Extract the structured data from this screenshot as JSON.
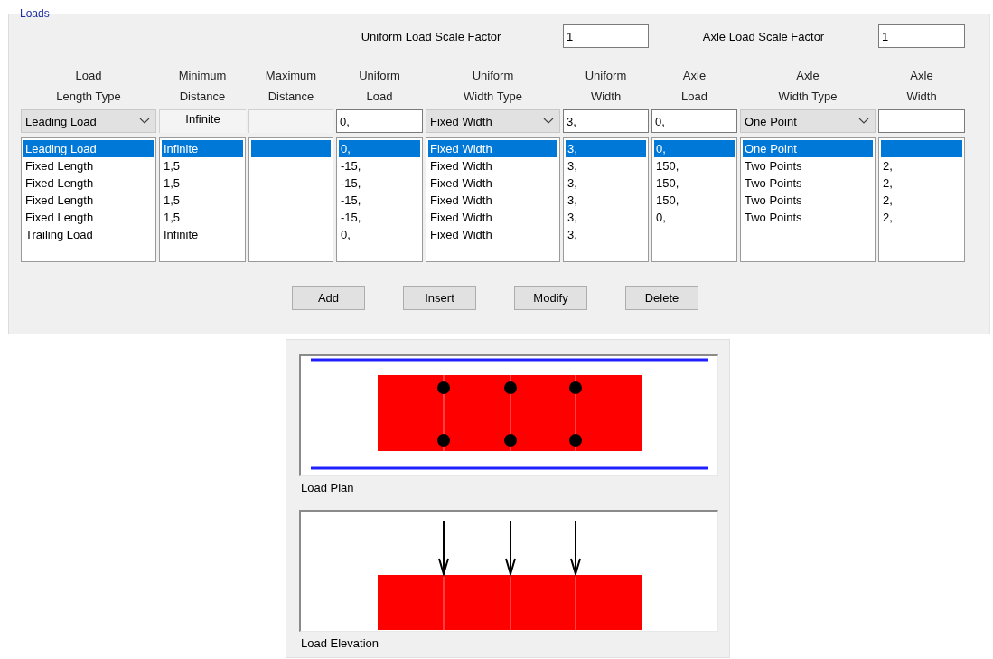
{
  "group": {
    "title": "Loads"
  },
  "scale_factors": [
    {
      "label": "Uniform Load Scale Factor",
      "value": "1"
    },
    {
      "label": "Axle Load Scale Factor",
      "value": "1"
    }
  ],
  "columns": [
    {
      "header": [
        "Load",
        "Length Type"
      ],
      "editor": {
        "kind": "combo",
        "value": "Leading Load"
      }
    },
    {
      "header": [
        "Minimum",
        "Distance"
      ],
      "editor": {
        "kind": "readonly",
        "value": "Infinite"
      }
    },
    {
      "header": [
        "Maximum",
        "Distance"
      ],
      "editor": {
        "kind": "readonly"
      }
    },
    {
      "header": [
        "Uniform",
        "Load"
      ],
      "editor": {
        "kind": "input",
        "value": "0,"
      }
    },
    {
      "header": [
        "Uniform",
        "Width Type"
      ],
      "editor": {
        "kind": "combo",
        "value": "Fixed Width"
      }
    },
    {
      "header": [
        "Uniform",
        "Width"
      ],
      "editor": {
        "kind": "input",
        "value": "3,"
      }
    },
    {
      "header": [
        "Axle",
        "Load"
      ],
      "editor": {
        "kind": "input",
        "value": "0,"
      }
    },
    {
      "header": [
        "Axle",
        "Width Type"
      ],
      "editor": {
        "kind": "combo",
        "value": "One Point"
      }
    },
    {
      "header": [
        "Axle",
        "Width"
      ],
      "editor": {
        "kind": "input"
      }
    }
  ],
  "rows": [
    {
      "selected": true,
      "cells": [
        "Leading Load",
        "Infinite",
        null,
        "0,",
        "Fixed Width",
        "3,",
        "0,",
        "One Point",
        null
      ]
    },
    {
      "selected": false,
      "cells": [
        "Fixed Length",
        "1,5",
        null,
        "-15,",
        "Fixed Width",
        "3,",
        "150,",
        "Two Points",
        "2,"
      ]
    },
    {
      "selected": false,
      "cells": [
        "Fixed Length",
        "1,5",
        null,
        "-15,",
        "Fixed Width",
        "3,",
        "150,",
        "Two Points",
        "2,"
      ]
    },
    {
      "selected": false,
      "cells": [
        "Fixed Length",
        "1,5",
        null,
        "-15,",
        "Fixed Width",
        "3,",
        "150,",
        "Two Points",
        "2,"
      ]
    },
    {
      "selected": false,
      "cells": [
        "Fixed Length",
        "1,5",
        null,
        "-15,",
        "Fixed Width",
        "3,",
        "0,",
        "Two Points",
        "2,"
      ]
    },
    {
      "selected": false,
      "cells": [
        "Trailing Load",
        "Infinite",
        null,
        "0,",
        "Fixed Width",
        "3,",
        null,
        null,
        null
      ]
    }
  ],
  "buttons": [
    "Add",
    "Insert",
    "Modify",
    "Delete"
  ],
  "views": [
    {
      "kind": "plan",
      "label": "Load Plan"
    },
    {
      "kind": "elevation",
      "label": "Load Elevation"
    }
  ]
}
